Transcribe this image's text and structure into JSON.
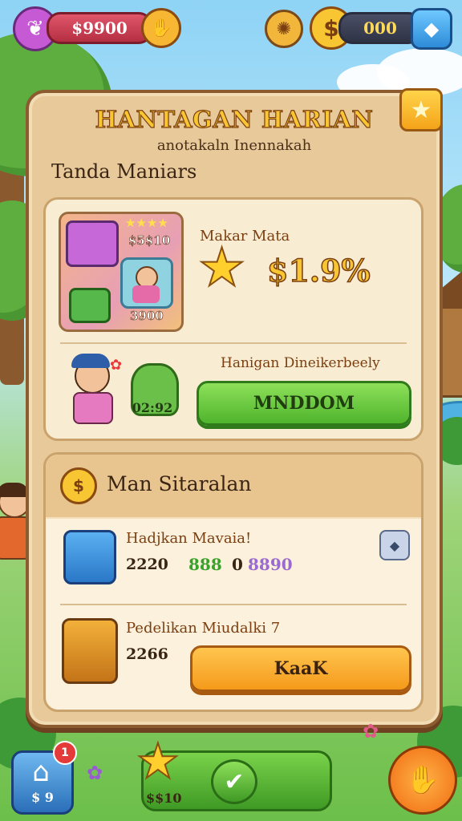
{
  "top_bar": {
    "left_currency": "$9900",
    "right_currency": "000"
  },
  "panel": {
    "title": "HANTAGAN HARIAN",
    "subtitle": "anotakaln Inennakah",
    "section_label": "Tanda Maniars",
    "reward_card": {
      "box_top_value": "$5$10",
      "box_bottom_value": "3900",
      "reward_label": "Makar Mata",
      "reward_amount": "$1.9%",
      "timer_value": "02:92",
      "claim_hint": "Hanigan Dineikerbeely",
      "claim_button": "MNDDOM"
    },
    "missions": {
      "header": "Man Sitaralan",
      "items": [
        {
          "title": "Hadjkan Mavaia!",
          "value": "2220",
          "gems": [
            "888",
            "0",
            "8890"
          ]
        },
        {
          "title": "Pedelikan Miudalki 7",
          "value": "2266",
          "button": "KaaK"
        }
      ]
    }
  },
  "bottom": {
    "left_badge_count": "1",
    "left_value": "$ 9",
    "center_value": "$$10"
  },
  "colors": {
    "panel": "#e7c99a",
    "title_gold": "#f7c632",
    "green_button": "#4fb42c",
    "orange_button": "#f59a1a"
  }
}
